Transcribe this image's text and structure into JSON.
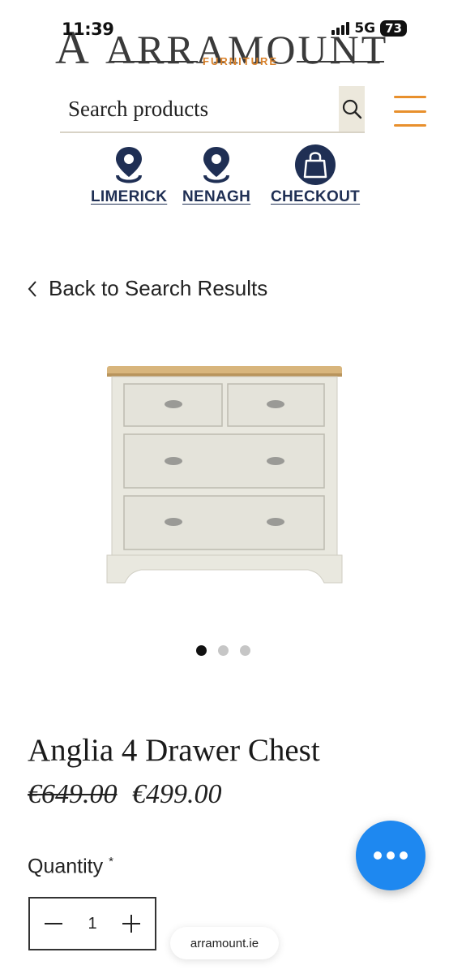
{
  "status_bar": {
    "time": "11:39",
    "network": "5G",
    "battery": "73"
  },
  "logo": {
    "mark": "A",
    "name": "ARRAMOUNT",
    "tagline": "FURNITURE"
  },
  "search": {
    "placeholder": "Search products"
  },
  "locations": [
    {
      "label": "LIMERICK",
      "icon": "map-pin-icon"
    },
    {
      "label": "NENAGH",
      "icon": "map-pin-icon"
    },
    {
      "label": "CHECKOUT",
      "icon": "shopping-bag-icon"
    }
  ],
  "back_link": "Back to Search Results",
  "gallery": {
    "image_count": 3,
    "active_index": 0
  },
  "product": {
    "title": "Anglia 4 Drawer Chest",
    "price_old": "€649.00",
    "price_new": "€499.00"
  },
  "quantity": {
    "label": "Quantity",
    "required_mark": "*",
    "value": "1"
  },
  "browser": {
    "url": "arramount.ie"
  },
  "colors": {
    "accent_orange": "#e8902d",
    "navy": "#1f2f54",
    "chat_blue": "#1e88f0"
  }
}
